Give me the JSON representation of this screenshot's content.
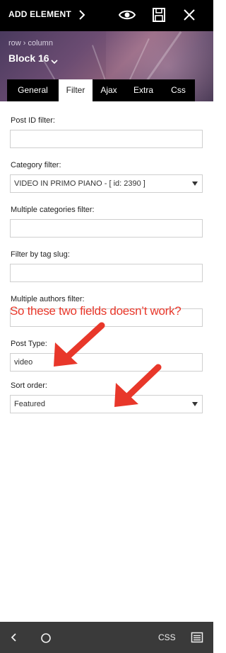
{
  "topbar": {
    "add_element_label": "ADD ELEMENT",
    "icons": [
      "chevron-right-icon",
      "eye-icon",
      "save-icon",
      "close-icon"
    ]
  },
  "header": {
    "breadcrumb": "row › column",
    "title": "Block 16"
  },
  "tabs": [
    {
      "label": "General",
      "active": false
    },
    {
      "label": "Filter",
      "active": true
    },
    {
      "label": "Ajax",
      "active": false
    },
    {
      "label": "Extra",
      "active": false
    },
    {
      "label": "Css",
      "active": false
    }
  ],
  "form": {
    "post_id_filter": {
      "label": "Post ID filter:",
      "value": ""
    },
    "category_filter": {
      "label": "Category filter:",
      "value": "VIDEO IN PRIMO PIANO - [ id: 2390 ]"
    },
    "multiple_categories_filter": {
      "label": "Multiple categories filter:",
      "value": ""
    },
    "filter_by_tag_slug": {
      "label": "Filter by tag slug:",
      "value": ""
    },
    "multiple_authors_filter": {
      "label": "Multiple authors filter:",
      "value": ""
    },
    "post_type": {
      "label": "Post Type:",
      "value": "video"
    },
    "sort_order": {
      "label": "Sort order:",
      "value": "Featured"
    }
  },
  "annotation": {
    "text": "So these two fields doesn’t work?",
    "color": "#e8372a"
  },
  "bottombar": {
    "css_label": "CSS",
    "icons": [
      "back-icon",
      "home-circle-icon",
      "menu-icon"
    ]
  },
  "colors": {
    "bar_black": "#000000",
    "bottom_bar": "#3a3a3a",
    "field_border": "#cfcfcf",
    "annotation_red": "#e8372a"
  }
}
